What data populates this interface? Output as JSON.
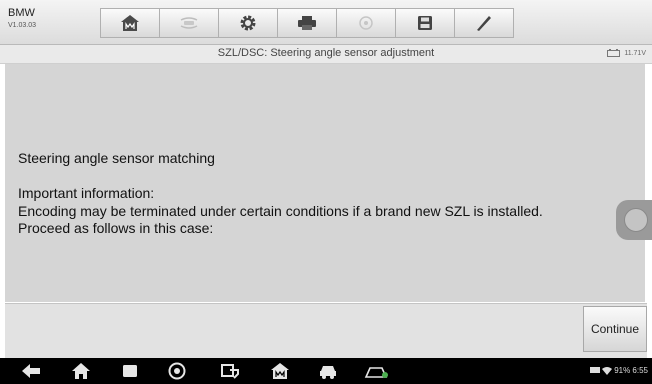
{
  "app": {
    "brand": "BMW",
    "version": "V1.03.03"
  },
  "toolbar": {
    "buttons": [
      {
        "icon": "home-icon"
      },
      {
        "icon": "vehicle-swap-icon"
      },
      {
        "icon": "gear-icon"
      },
      {
        "icon": "print-icon"
      },
      {
        "icon": "help-icon"
      },
      {
        "icon": "save-icon"
      },
      {
        "icon": "pen-icon"
      }
    ]
  },
  "header": {
    "title": "SZL/DSC: Steering angle sensor adjustment",
    "battery_voltage": "11.71V"
  },
  "main": {
    "heading": "Steering angle sensor matching",
    "info_title": "Important information:",
    "info_line1": "Encoding may be terminated under certain conditions if a brand new SZL is installed.",
    "info_line2": "Proceed as follows in this case:"
  },
  "footer": {
    "continue_label": "Continue"
  },
  "system_bar": {
    "status_text": "91% 6:55"
  },
  "colors": {
    "background": "#d5d5d5",
    "toolbar": "#e6e6e6",
    "nav": "#000000"
  }
}
